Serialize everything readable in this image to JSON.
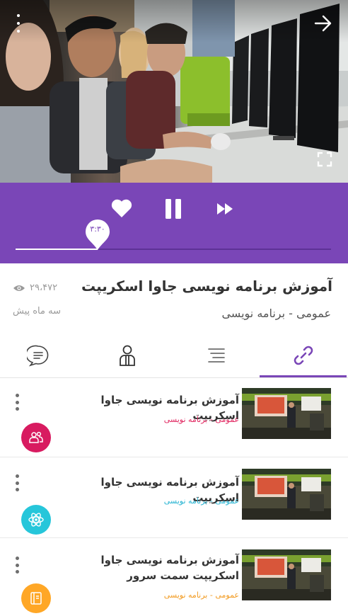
{
  "video": {
    "current_time": "۳:۳۰",
    "progress": 0.26
  },
  "info": {
    "title": "آموزش برنامه نویسی جاوا اسکریپت",
    "subtitle": "عمومی - برنامه نویسی",
    "views": "۲۹،۴۷۲",
    "date": "سه ماه پیش"
  },
  "tabs": [
    {
      "icon": "link-icon",
      "active": true
    },
    {
      "icon": "list-icon",
      "active": false
    },
    {
      "icon": "person-icon",
      "active": false
    },
    {
      "icon": "comments-icon",
      "active": false
    }
  ],
  "playlist": [
    {
      "title": "آموزش برنامه نویسی جاوا اسکریپت",
      "category": "عمومی - برنامه نویسی",
      "category_color": "#e0245e",
      "badge_color": "#d81b60",
      "badge_icon": "people-icon"
    },
    {
      "title": "آموزش برنامه نویسی جاوا اسکریپت",
      "category": "عمومی - برنامه نویسی",
      "category_color": "#26b3d2",
      "badge_color": "#26c6da",
      "badge_icon": "atom-icon"
    },
    {
      "title": "آموزش برنامه نویسی جاوا اسکریپت سمت سرور",
      "category": "عمومی - برنامه نویسی",
      "category_color": "#f29a1f",
      "badge_color": "#ffa726",
      "badge_icon": "book-icon"
    }
  ],
  "colors": {
    "accent": "#7a46b7"
  }
}
